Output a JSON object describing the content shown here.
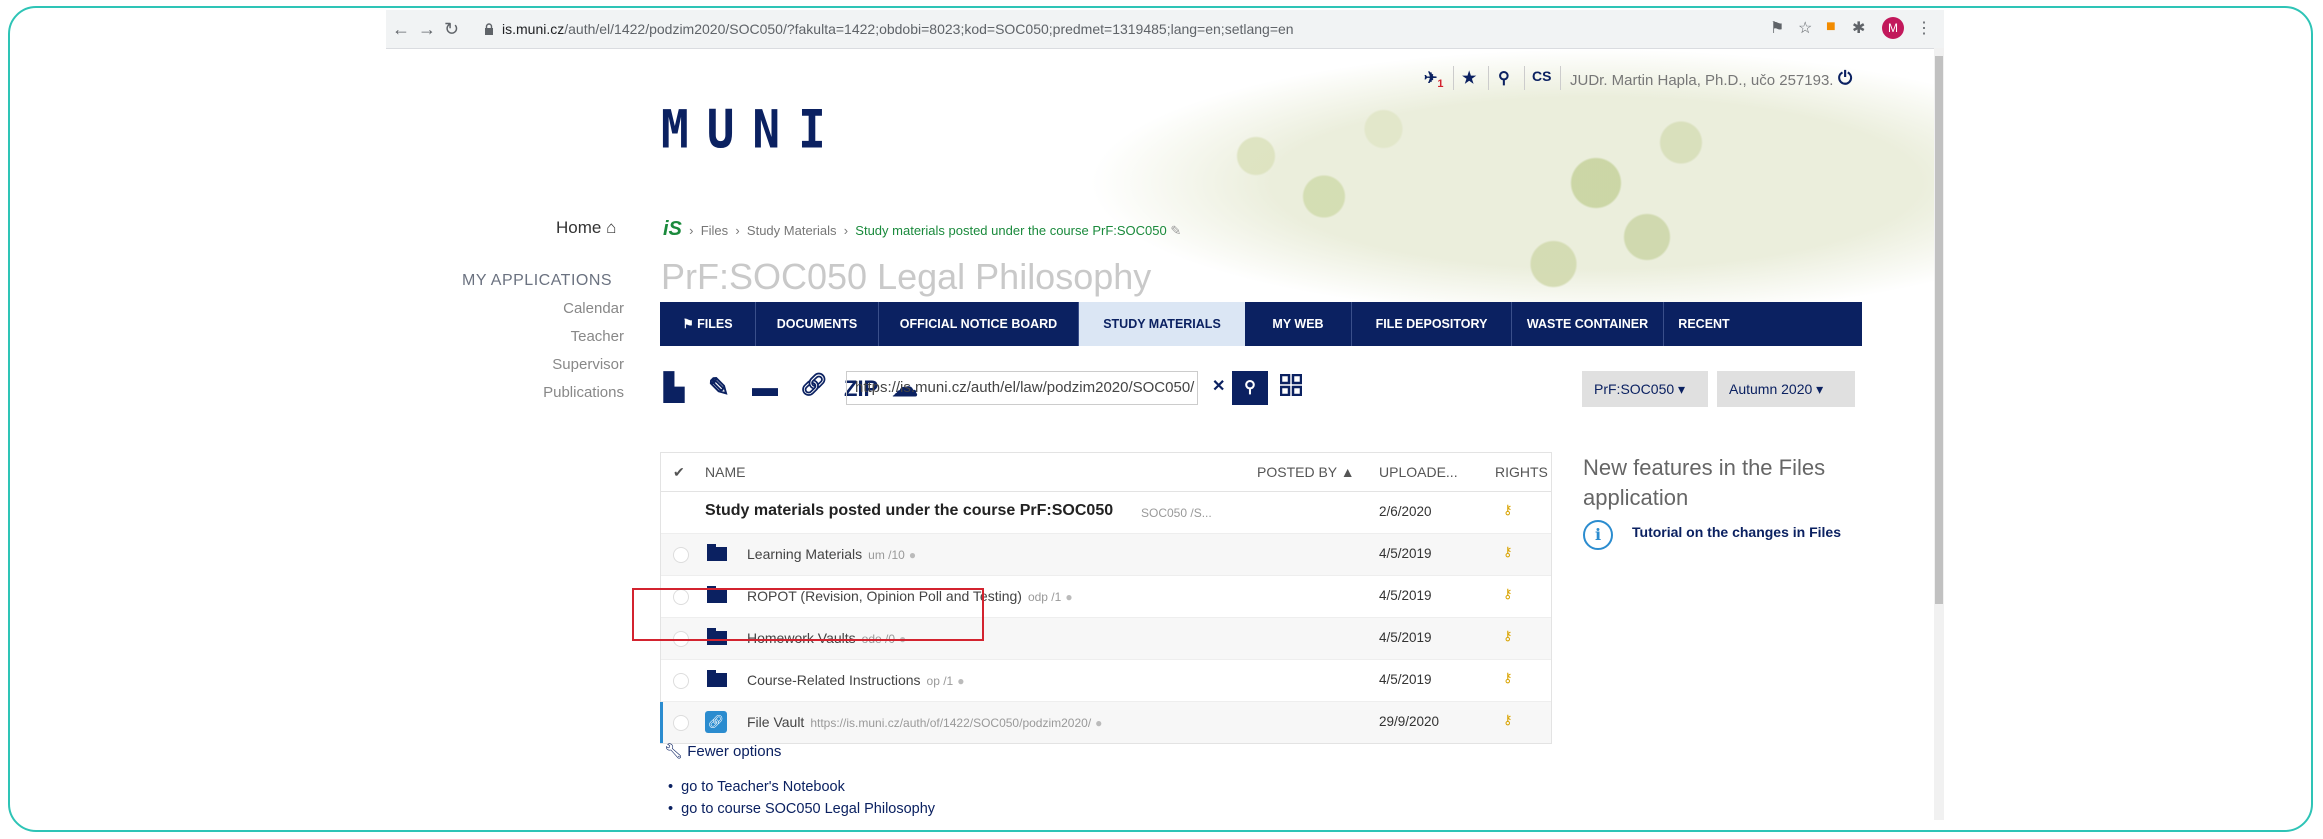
{
  "browser": {
    "url_host": "is.muni.cz",
    "url_path": "/auth/el/1422/podzim2020/SOC050/?fakulta=1422;obdobi=8023;kod=SOC050;predmet=1319485;lang=en;setlang=en",
    "avatar_letter": "M"
  },
  "header": {
    "logo": "MUNI",
    "notif_count": "1",
    "lang": "CS",
    "user": "JUDr. Martin Hapla, Ph.D., učo 257193."
  },
  "leftnav": {
    "home": "Home",
    "my_apps": "MY APPLICATIONS",
    "items": [
      "Calendar",
      "Teacher",
      "Supervisor",
      "Publications"
    ]
  },
  "breadcrumb": {
    "is": "iS",
    "items": [
      "Files",
      "Study Materials"
    ],
    "current": "Study materials posted under the course PrF:SOC050"
  },
  "page_title": "PrF:SOC050 Legal Philosophy",
  "tabs": [
    "FILES",
    "DOCUMENTS",
    "OFFICIAL NOTICE BOARD",
    "STUDY MATERIALS",
    "MY WEB",
    "FILE DEPOSITORY",
    "WASTE CONTAINER",
    "RECENT"
  ],
  "toolbar": {
    "zip": "ZIP",
    "path": "https://is.muni.cz/auth/el/law/podzim2020/SOC050/",
    "course_select": "PrF:SOC050",
    "term_select": "Autumn 2020"
  },
  "table": {
    "headers": {
      "name": "NAME",
      "posted_by": "POSTED BY ▲",
      "uploaded": "UPLOADE...",
      "rights": "RIGHTS"
    },
    "parent": {
      "name": "Study materials posted under the course PrF:SOC050",
      "meta": "SOC050 /S...",
      "date": "2/6/2020"
    },
    "rows": [
      {
        "name": "Learning Materials",
        "meta": "um /10",
        "date": "4/5/2019"
      },
      {
        "name": "ROPOT (Revision, Opinion Poll and Testing)",
        "meta": "odp /1",
        "date": "4/5/2019"
      },
      {
        "name": "Homework Vaults",
        "meta": "ode /0",
        "date": "4/5/2019"
      },
      {
        "name": "Course-Related Instructions",
        "meta": "op /1",
        "date": "4/5/2019"
      },
      {
        "name": "File Vault",
        "meta": "https://is.muni.cz/auth/of/1422/SOC050/podzim2020/",
        "date": "29/9/2020"
      }
    ]
  },
  "side": {
    "heading": "New features in the Files application",
    "tutorial": "Tutorial on the changes in Files"
  },
  "bottom": {
    "fewer": "Fewer options",
    "links": [
      "go to Teacher's Notebook",
      "go to course SOC050 Legal Philosophy"
    ]
  },
  "colors": {
    "brand": "#0b2161",
    "accent": "#2b8ccf",
    "highlight": "#d3232f",
    "frame": "#2ec4b6"
  }
}
